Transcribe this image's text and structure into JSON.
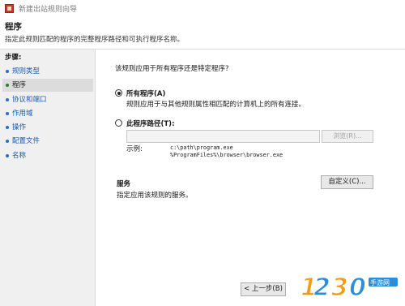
{
  "window": {
    "title": "新建出站规则向导"
  },
  "header": {
    "title": "程序",
    "description": "指定此规则匹配的程序的完整程序路径和可执行程序名称。"
  },
  "sidebar": {
    "steps_label": "步骤:",
    "items": [
      {
        "label": "规则类型"
      },
      {
        "label": "程序"
      },
      {
        "label": "协议和端口"
      },
      {
        "label": "作用域"
      },
      {
        "label": "操作"
      },
      {
        "label": "配置文件"
      },
      {
        "label": "名称"
      }
    ],
    "active_index": 1
  },
  "main": {
    "question": "该规则应用于所有程序还是特定程序?",
    "all_programs": {
      "label": "所有程序(A)",
      "description": "规则应用于与其他规则属性相匹配的计算机上的所有连接。",
      "selected": true
    },
    "program_path": {
      "label": "此程序路径(T):",
      "value": "",
      "selected": false,
      "browse_label": "浏览(R)...",
      "example_label": "示例:",
      "example_paths": [
        "c:\\path\\program.exe",
        "%ProgramFiles%\\browser\\browser.exe"
      ]
    },
    "services": {
      "title": "服务",
      "description": "指定应用该规则的服务。",
      "customize_label": "自定义(C)..."
    }
  },
  "footer": {
    "back_label": "< 上一步(B)"
  },
  "watermark": {
    "text": "1230手游网"
  },
  "colors": {
    "link": "#1a5aa8",
    "bullet": "#2b6cc4",
    "active_bullet": "#2e7d2e",
    "watermark_orange": "#f39c12"
  }
}
